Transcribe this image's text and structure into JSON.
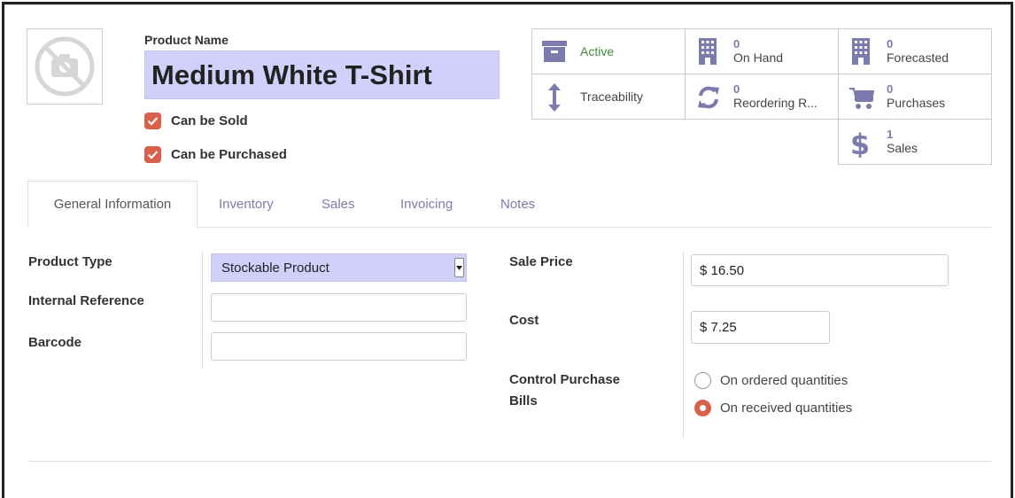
{
  "header": {
    "product_name_label": "Product Name",
    "product_name": "Medium White T-Shirt",
    "photo_icon": "no-camera-icon",
    "checkboxes": [
      {
        "label": "Can be Sold",
        "checked": true
      },
      {
        "label": "Can be Purchased",
        "checked": true
      }
    ]
  },
  "stat_buttons": {
    "active": {
      "label": "Active",
      "icon": "archive-icon",
      "color": "#3e8b3e"
    },
    "traceability": {
      "label": "Traceability",
      "icon": "vertical-arrows-icon"
    },
    "on_hand": {
      "count": "0",
      "label": "On Hand",
      "icon": "building-icon"
    },
    "reordering": {
      "count": "0",
      "label": "Reordering R...",
      "icon": "refresh-icon"
    },
    "forecasted": {
      "count": "0",
      "label": "Forecasted",
      "icon": "building-icon"
    },
    "purchases": {
      "count": "0",
      "label": "Purchases",
      "icon": "shopping-cart-icon"
    },
    "sales": {
      "count": "1",
      "label": "Sales",
      "icon": "dollar-icon"
    }
  },
  "tabs": [
    {
      "label": "General Information",
      "active": true
    },
    {
      "label": "Inventory",
      "active": false
    },
    {
      "label": "Sales",
      "active": false
    },
    {
      "label": "Invoicing",
      "active": false
    },
    {
      "label": "Notes",
      "active": false
    }
  ],
  "form": {
    "product_type": {
      "label": "Product Type",
      "value": "Stockable Product"
    },
    "internal_reference": {
      "label": "Internal Reference",
      "value": ""
    },
    "barcode": {
      "label": "Barcode",
      "value": ""
    },
    "sale_price": {
      "label": "Sale Price",
      "value": "$ 16.50"
    },
    "cost": {
      "label": "Cost",
      "value": "$ 7.25"
    },
    "control_purchase_bills": {
      "label_line1": "Control Purchase",
      "label_line2": "Bills",
      "options": [
        {
          "label": "On ordered quantities",
          "selected": false
        },
        {
          "label": "On received quantities",
          "selected": true
        }
      ]
    }
  },
  "colors": {
    "accent": "#7c7bad",
    "checkbox": "#d9614a",
    "highlight_field": "#d0d0fa"
  }
}
